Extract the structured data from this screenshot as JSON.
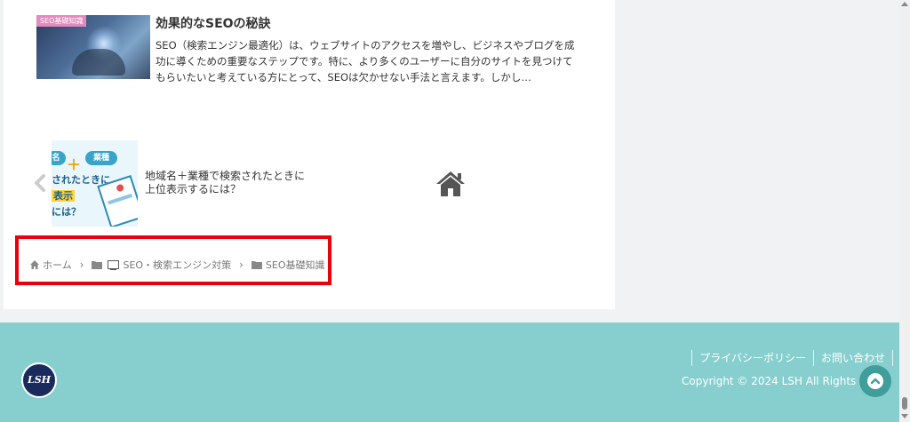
{
  "article": {
    "category_badge": "SEO基礎知識",
    "title": "効果的なSEOの秘訣",
    "excerpt": "SEO（検索エンジン最適化）は、ウェブサイトのアクセスを増やし、ビジネスやブログを成功に導くための重要なステップです。特に、より多くのユーザーに自分のサイトを見つけてもらいたいと考えている方にとって、SEOは欠かせない手法と言えます。しかし…"
  },
  "related": {
    "title": "地域名＋業種で検索されたときに上位表示するには？",
    "thumb": {
      "pill_left": "名",
      "pill_right": "業種",
      "plus": "＋",
      "line1": "されたときに",
      "line2": "表示",
      "line3": "には？"
    }
  },
  "breadcrumb": {
    "items": [
      {
        "label": "ホーム",
        "icon": "home-icon"
      },
      {
        "label": "SEO・検索エンジン対策",
        "icon": "folder-icon"
      },
      {
        "label": "SEO基礎知識",
        "icon": "folder-icon"
      }
    ],
    "separator": "›"
  },
  "footer": {
    "logo_text": "LSH",
    "links": [
      "プライバシーポリシー",
      "お問い合わせ"
    ],
    "copyright": "Copyright © 2024 LSH All Rights Res"
  },
  "colors": {
    "footer_bg": "#86cfce",
    "highlight_border": "#e8000b",
    "badge_bg": "#e38bbd",
    "to_top_bg": "#3f9d9a"
  }
}
